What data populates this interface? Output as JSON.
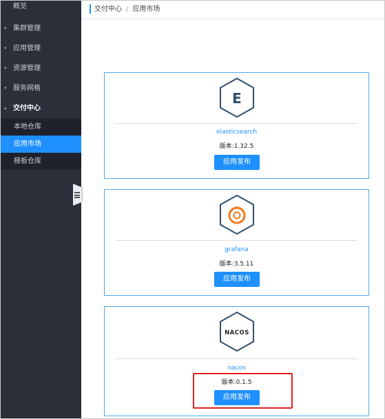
{
  "sidebar": {
    "items": [
      {
        "label": "概览"
      },
      {
        "label": "集群管理"
      },
      {
        "label": "应用管理"
      },
      {
        "label": "资源管理"
      },
      {
        "label": "服务网格"
      },
      {
        "label": "交付中心"
      }
    ],
    "subitems": [
      {
        "label": "本地仓库"
      },
      {
        "label": "应用市场"
      },
      {
        "label": "模板仓库"
      }
    ],
    "collapse_caret": "▾",
    "expand_caret": "▴"
  },
  "breadcrumb": {
    "parent": "交付中心",
    "separator": "/",
    "current": "应用市场"
  },
  "cards": [
    {
      "name": "elasticsearch",
      "version": "版本:1.32.5",
      "button": "应用发布",
      "logo_text": "E"
    },
    {
      "name": "grafana",
      "version": "版本:3.5.11",
      "button": "应用发布"
    },
    {
      "name": "nacos",
      "version": "版本:0.1.5",
      "button": "应用发布",
      "logo_text": "NACOS"
    }
  ],
  "colors": {
    "accent": "#1e90ff",
    "sidebar_bg": "#2b2f3a",
    "highlight": "#e02020",
    "logo_stroke": "#2f4f6f",
    "grafana_orange": "#f47a20"
  },
  "icons": {
    "elasticsearch": "elasticsearch-logo-icon",
    "grafana": "grafana-logo-icon",
    "nacos": "nacos-logo-icon"
  }
}
